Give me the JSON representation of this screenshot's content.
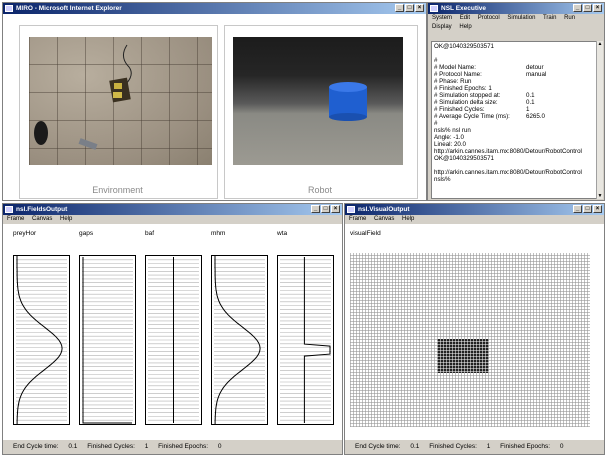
{
  "ie": {
    "title": "MIRO - Microsoft Internet Explorer",
    "env_caption": "Environment",
    "robot_caption": "Robot"
  },
  "nsl": {
    "title": "NSL Executive",
    "menu": [
      "System",
      "Edit",
      "Protocol",
      "Simulation",
      "Train",
      "Run",
      "Display",
      "Help"
    ],
    "console": [
      {
        "k": "OK@1040329503571",
        "v": ""
      },
      {
        "k": "",
        "v": ""
      },
      {
        "k": "#",
        "v": ""
      },
      {
        "k": "# Model Name:",
        "v": "detour"
      },
      {
        "k": "# Protocol Name:",
        "v": "manual"
      },
      {
        "k": "# Phase:          Run",
        "v": ""
      },
      {
        "k": "# Finished Epochs:  1",
        "v": ""
      },
      {
        "k": "# Simulation stopped at:",
        "v": "0.1"
      },
      {
        "k": "# Simulation delta size:",
        "v": "0.1"
      },
      {
        "k": "# Finished Cycles:",
        "v": "1"
      },
      {
        "k": "# Average Cycle Time (ms):",
        "v": "6265.0"
      },
      {
        "k": "#",
        "v": ""
      },
      {
        "k": "nsls% nsl run",
        "v": ""
      },
      {
        "k": "Angle: -1.0",
        "v": ""
      },
      {
        "k": "Lineal: 20.0",
        "v": ""
      },
      {
        "k": "http://arkin.cannes.itam.mx:8080/Detour/RobotControl",
        "v": ""
      },
      {
        "k": "OK@1040329503571",
        "v": ""
      },
      {
        "k": "",
        "v": ""
      },
      {
        "k": "http://arkin.cannes.itam.mx:8080/Detour/RobotControl",
        "v": ""
      },
      {
        "k": "nsls%",
        "v": ""
      }
    ]
  },
  "fields": {
    "title": "nsl.FieldsOutput",
    "menu": [
      "Frame",
      "Canvas",
      "Help"
    ],
    "panels": [
      {
        "label": "preyHor",
        "curve": "gauss-left"
      },
      {
        "label": "gaps",
        "curve": "flat"
      },
      {
        "label": "baf",
        "curve": "vline"
      },
      {
        "label": "mhm",
        "curve": "gauss-left"
      },
      {
        "label": "wta",
        "curve": "spike"
      }
    ],
    "status": {
      "cycle_label": "End Cycle time:",
      "cycle_value": "0.1",
      "cycles_label": "Finished Cycles:",
      "cycles_value": "1",
      "epochs_label": "Finished Epochs:",
      "epochs_value": "0"
    }
  },
  "visual": {
    "title": "nsl.VisualOutput",
    "menu": [
      "Frame",
      "Canvas",
      "Help"
    ],
    "label": "visualField",
    "status": {
      "cycle_label": "End Cycle time:",
      "cycle_value": "0.1",
      "cycles_label": "Finished Cycles:",
      "cycles_value": "1",
      "epochs_label": "Finished Epochs:",
      "epochs_value": "0"
    }
  }
}
